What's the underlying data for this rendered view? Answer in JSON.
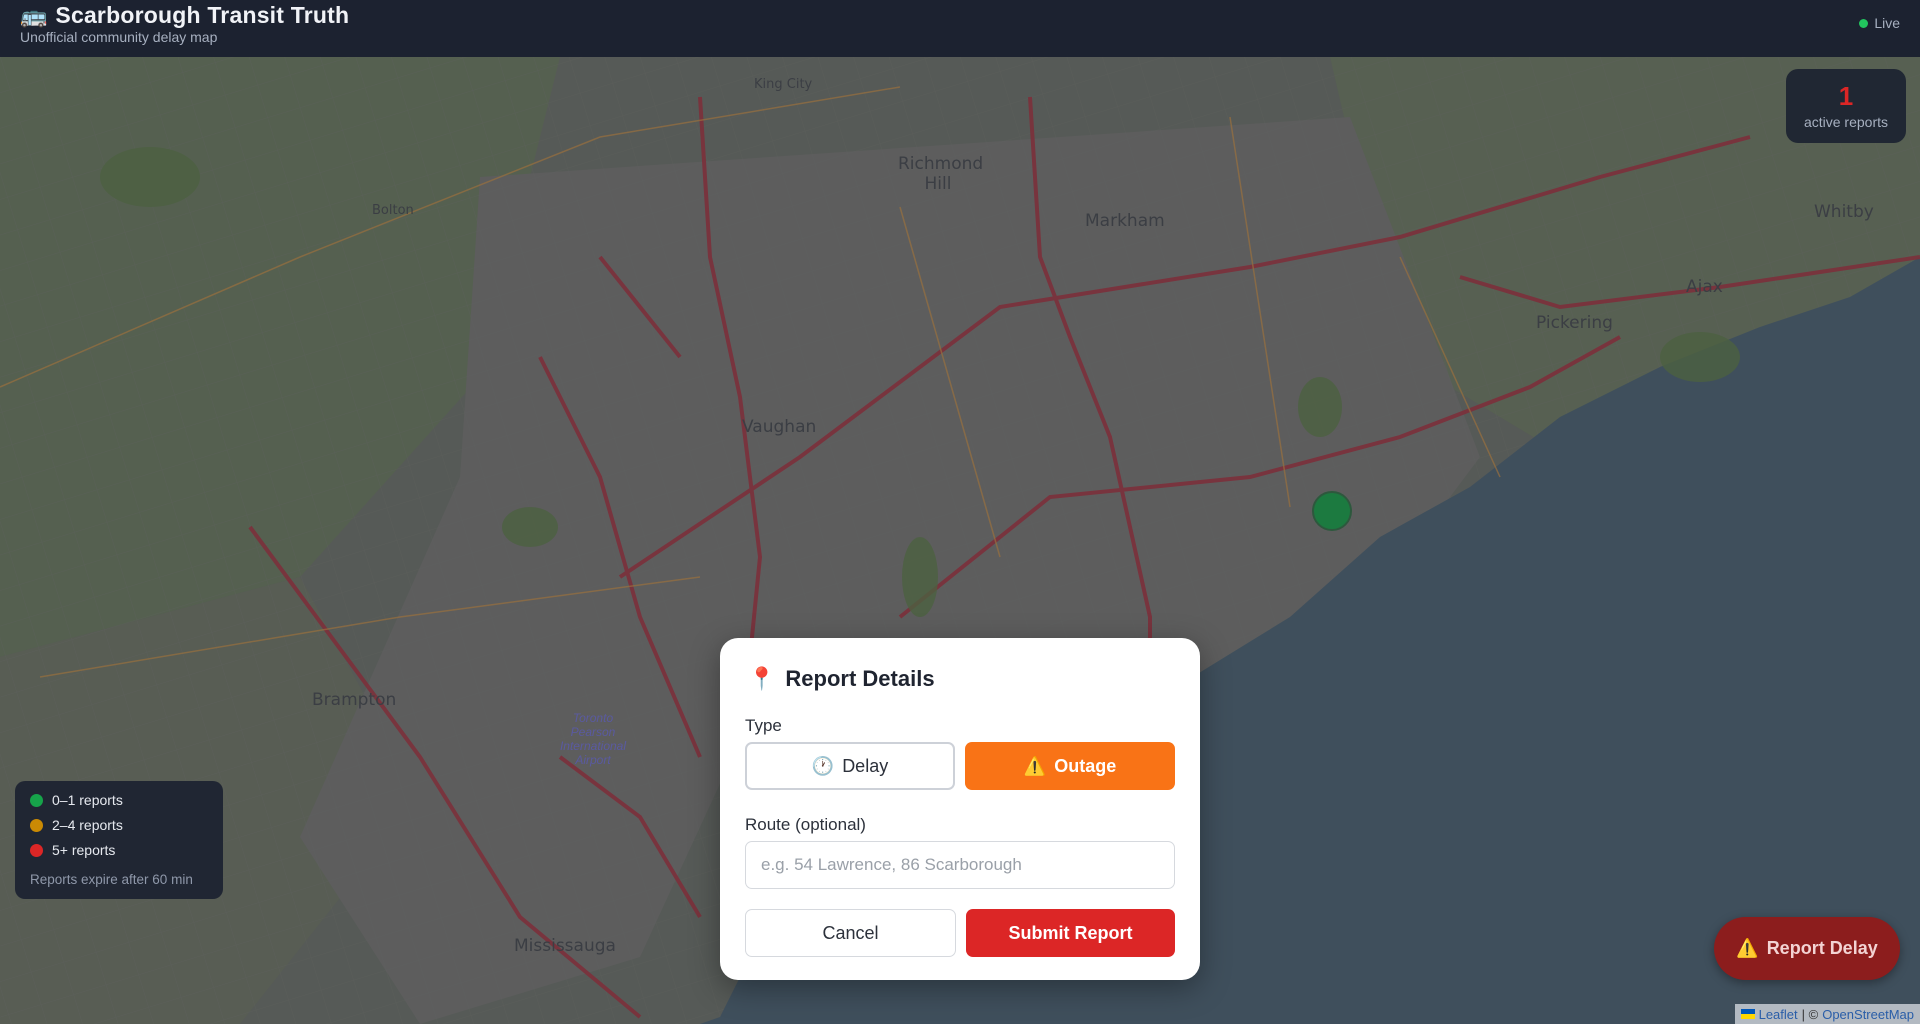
{
  "header": {
    "emoji": "🚌",
    "title": "Scarborough Transit Truth",
    "subtitle": "Unofficial community delay map",
    "status": "Live"
  },
  "counter": {
    "count": "1",
    "label": "active reports"
  },
  "legend": {
    "items": [
      {
        "label": "0–1 reports",
        "color": "#16a34a"
      },
      {
        "label": "2–4 reports",
        "color": "#ca8a04"
      },
      {
        "label": "5+ reports",
        "color": "#dc2626"
      }
    ],
    "note": "Reports expire after 60 min"
  },
  "map": {
    "cities": [
      "King City",
      "Bolton",
      "Richmond Hill",
      "Markham",
      "Whitby",
      "Ajax",
      "Pickering",
      "Vaughan",
      "Brampton",
      "Mississauga"
    ],
    "airport": "Toronto Pearson International Airport",
    "marker_color": "#16a34a",
    "attribution": {
      "leaflet": "Leaflet",
      "separator": "| ©",
      "osm": "OpenStreetMap"
    }
  },
  "fab": {
    "icon": "⚠️",
    "label": "Report Delay"
  },
  "modal": {
    "icon": "📍",
    "title": "Report Details",
    "type_label": "Type",
    "delay_icon": "🕐",
    "delay_label": "Delay",
    "outage_icon": "⚠️",
    "outage_label": "Outage",
    "selected_type": "Outage",
    "route_label": "Route (optional)",
    "route_placeholder": "e.g. 54 Lawrence, 86 Scarborough",
    "route_value": "",
    "cancel_label": "Cancel",
    "submit_label": "Submit Report"
  }
}
